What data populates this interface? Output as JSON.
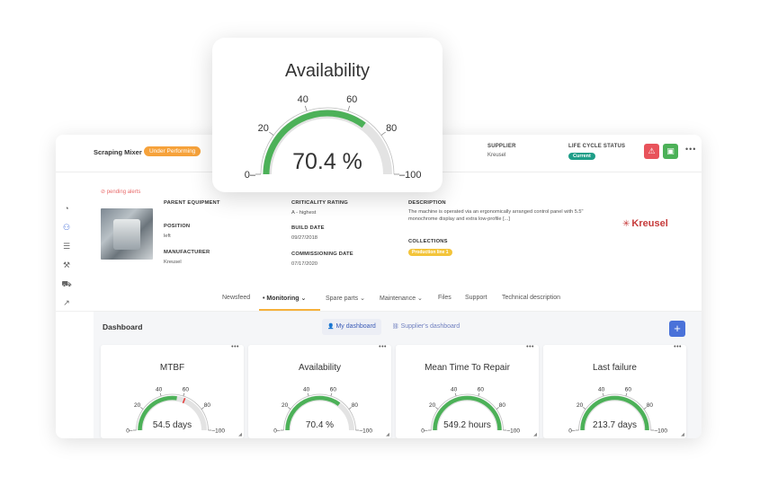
{
  "header": {
    "asset_name": "Scraping Mixer",
    "status_badge": "Under Performing",
    "supplier_label": "SUPPLIER",
    "supplier_value": "Kreusel",
    "lifecycle_label": "LIFE CYCLE STATUS",
    "lifecycle_value": "Current",
    "warning_icon": "⚠",
    "report_icon": "▣",
    "more_label": "•••",
    "colors": {
      "status_orange": "#f6a23b",
      "lifecycle_teal": "#1e9e88",
      "alert_red": "#e8535b",
      "action_green": "#4cb158"
    }
  },
  "sidebar": {
    "items": [
      {
        "icon": "gauge-icon",
        "glyph": "◔"
      },
      {
        "icon": "hierarchy-icon",
        "glyph": "⚇"
      },
      {
        "icon": "layers-icon",
        "glyph": "☰"
      },
      {
        "icon": "wrench-icon",
        "glyph": "⚒"
      },
      {
        "icon": "cart-icon",
        "glyph": "⛟"
      },
      {
        "icon": "chart-icon",
        "glyph": "↗"
      }
    ]
  },
  "details": {
    "pending_alerts": "⊘ pending alerts",
    "parent_equipment_label": "PARENT EQUIPMENT",
    "position_label": "POSITION",
    "position_value": "left",
    "manufacturer_label": "MANUFACTURER",
    "manufacturer_value": "Kreusel",
    "criticality_label": "CRITICALITY RATING",
    "criticality_value": "A - highest",
    "build_date_label": "BUILD DATE",
    "build_date_value": "09/27/2018",
    "commissioning_label": "COMMISSIONING DATE",
    "commissioning_value": "07/17/2020",
    "description_label": "DESCRIPTION",
    "description_value": "The machine is operated via an ergonomically arranged control panel with 5.5\" monochrome display and extra low-profile",
    "description_more": "[...]",
    "collections_label": "COLLECTIONS",
    "collections_value": "Production line 1",
    "brand_name": "Kreusel",
    "brand_mark": "✳"
  },
  "tabs": [
    {
      "label": "Newsfeed"
    },
    {
      "label": "• Monitoring ⌄"
    },
    {
      "label": "Spare parts ⌄"
    },
    {
      "label": "Maintenance ⌄"
    },
    {
      "label": "Files"
    },
    {
      "label": "Support"
    },
    {
      "label": "Technical description"
    }
  ],
  "dashboard": {
    "title": "Dashboard",
    "tab_mine": "My dashboard",
    "tab_supplier": "Supplier's dashboard",
    "add_label": "+",
    "widget_menu": "•••",
    "resize_glyph": "◢",
    "widgets": [
      {
        "title": "MTBF",
        "value_text": "54.5 days",
        "fraction": 0.545,
        "marker": 0.62
      },
      {
        "title": "Availability",
        "value_text": "70.4 %",
        "fraction": 0.704
      },
      {
        "title": "Mean Time To Repair",
        "value_text": "549.2 hours",
        "fraction": 1.0
      },
      {
        "title": "Last failure",
        "value_text": "213.7 days",
        "fraction": 1.0
      }
    ]
  },
  "gauge_ticks": [
    "0",
    "20",
    "40",
    "60",
    "80",
    "100"
  ],
  "floating_card": {
    "title": "Availability",
    "value_text": "70.4 %",
    "fraction": 0.704
  },
  "colors": {
    "gauge_fill": "#4cb158",
    "gauge_track": "#e3e3e3",
    "marker_red": "#e54040",
    "accent_blue": "#4a72d9"
  }
}
